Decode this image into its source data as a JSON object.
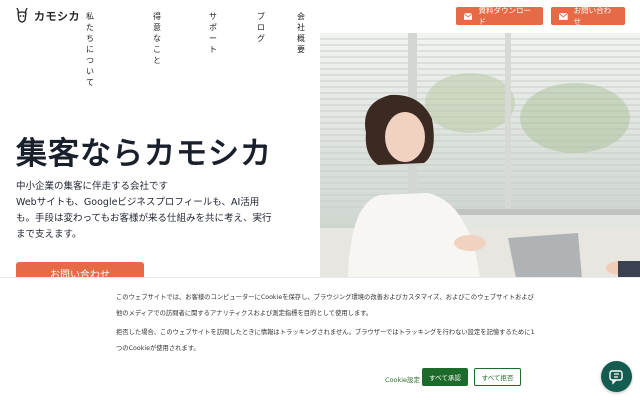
{
  "header": {
    "logo_text": "カモシカ",
    "nav": [
      "私たちについて",
      "得意なこと",
      "サポート",
      "ブログ",
      "会社概要"
    ],
    "doc_button": "資料ダウンロード",
    "contact_button": "お問い合わせ"
  },
  "hero": {
    "title": "集客ならカモシカ",
    "desc_line1": "中小企業の集客に伴走する会社です",
    "desc_line2": "Webサイトも、Googleビジネスプロフィールも、AI活用も。手段は変わってもお客様が来る仕組みを共に考え、実行まで支えます。",
    "cta": "お問い合わせ"
  },
  "cookie": {
    "text1": "このウェブサイトでは、お客様のコンピューターにCookieを保存し、ブラウジング環境の改善およびカスタマイズ、およびこのウェブサイトおよび他のメディアでの訪問者に関するアナリティクスおよび測定指標を目的として使用します。",
    "text2": "拒否した場合、このウェブサイトを訪問したときに情報はトラッキングされません。ブラウザーではトラッキングを行わない設定を記憶するために1つのCookieが使用されます。",
    "settings": "Cookie設定",
    "accept": "すべて承認",
    "reject": "すべて拒否"
  },
  "colors": {
    "accent": "#e66a45",
    "cookie_green": "#1d6b2b",
    "chat_bg": "#135c4f"
  },
  "icons": {
    "mail": "mail-icon",
    "chat": "chat-icon",
    "logo": "antelope-logo-icon"
  }
}
